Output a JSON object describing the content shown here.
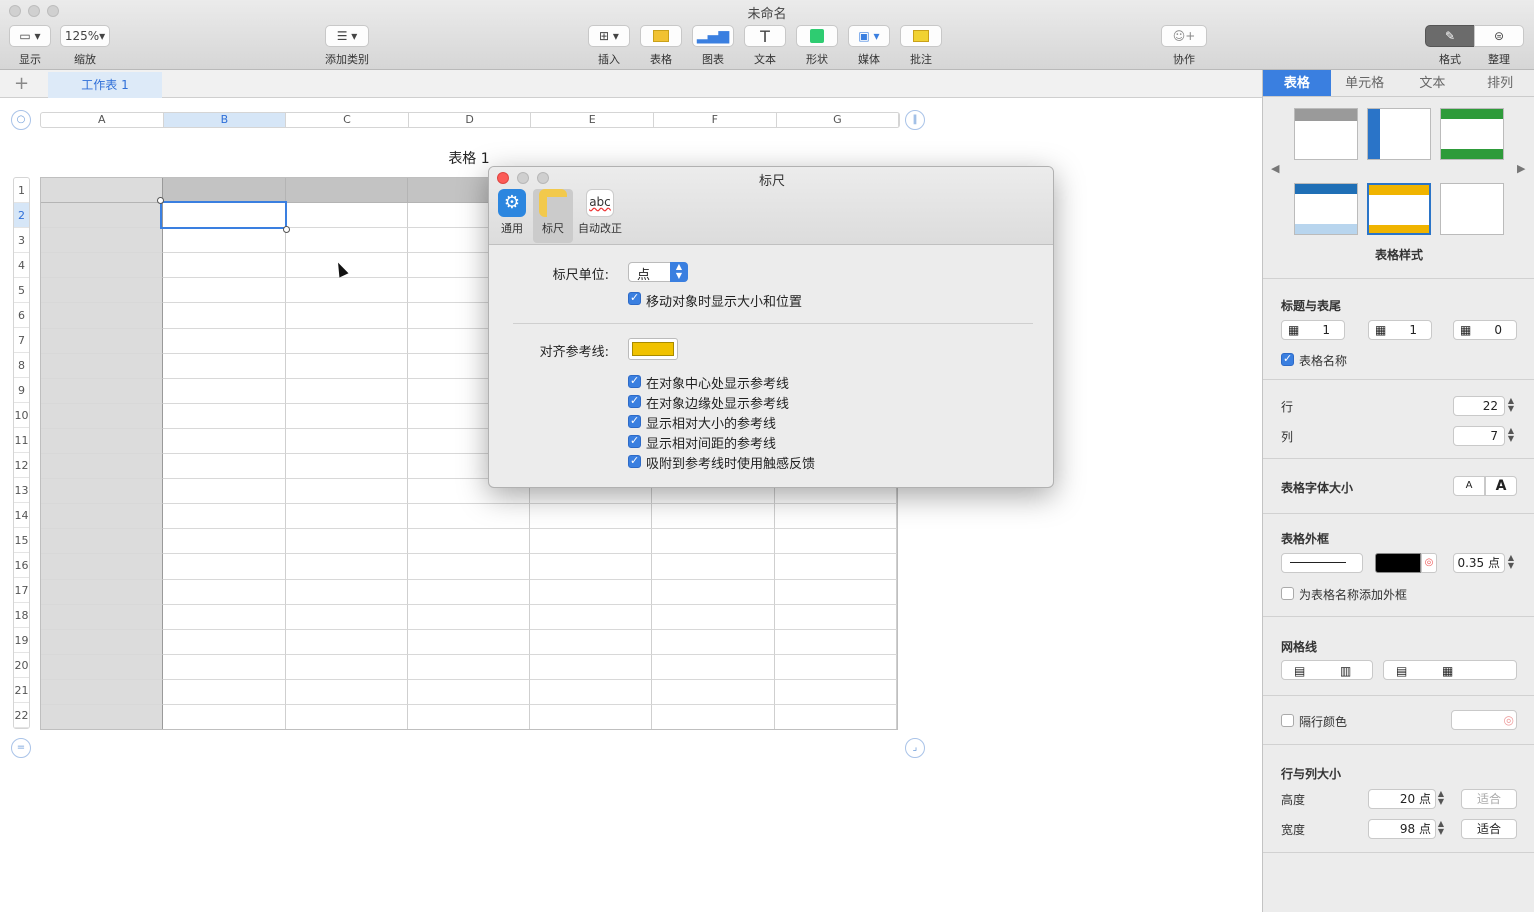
{
  "window": {
    "title": "未命名"
  },
  "toolbar": {
    "view": {
      "label": "显示"
    },
    "zoom": {
      "value": "125%",
      "label": "缩放"
    },
    "add_category": {
      "label": "添加类别"
    },
    "insert": {
      "label": "插入"
    },
    "table": {
      "label": "表格"
    },
    "chart": {
      "label": "图表"
    },
    "text": {
      "label": "文本",
      "glyph": "T"
    },
    "shape": {
      "label": "形状"
    },
    "media": {
      "label": "媒体"
    },
    "comment": {
      "label": "批注"
    },
    "collaborate": {
      "label": "协作"
    },
    "format": {
      "label": "格式"
    },
    "organize": {
      "label": "整理"
    }
  },
  "sheets": {
    "add": "+",
    "active": "工作表 1"
  },
  "spreadsheet": {
    "table_title": "表格 1",
    "columns": [
      "A",
      "B",
      "C",
      "D",
      "E",
      "F",
      "G"
    ],
    "selected_column": "B",
    "rows": [
      "1",
      "2",
      "3",
      "4",
      "5",
      "6",
      "7",
      "8",
      "9",
      "10",
      "11",
      "12",
      "13",
      "14",
      "15",
      "16",
      "17",
      "18",
      "19",
      "20",
      "21",
      "22"
    ],
    "selected_row": "2"
  },
  "inspector": {
    "tabs": [
      "表格",
      "单元格",
      "文本",
      "排列"
    ],
    "active_tab": "表格",
    "styles_label": "表格样式",
    "header_footer": {
      "title": "标题与表尾",
      "header_rows": "1",
      "header_cols": "1",
      "footer_rows": "0"
    },
    "table_name": {
      "label": "表格名称",
      "checked": true
    },
    "rows": {
      "label": "行",
      "value": "22"
    },
    "cols": {
      "label": "列",
      "value": "7"
    },
    "font_size": {
      "label": "表格字体大小",
      "small": "A",
      "large": "A"
    },
    "outline": {
      "title": "表格外框",
      "width": "0.35 点",
      "color": "#000000",
      "name_outline_label": "为表格名称添加外框"
    },
    "gridlines": {
      "title": "网格线"
    },
    "alternating": {
      "label": "隔行颜色"
    },
    "row_col_size": {
      "title": "行与列大小",
      "height_label": "高度",
      "height": "20 点",
      "width_label": "宽度",
      "width": "98 点",
      "fit": "适合"
    }
  },
  "dialog": {
    "title": "标尺",
    "tabs": [
      "通用",
      "标尺",
      "自动改正"
    ],
    "active_tab": "标尺",
    "abc_glyph": "abc",
    "ruler_units": {
      "label": "标尺单位:",
      "value": "点"
    },
    "show_size": "移动对象时显示大小和位置",
    "guides": {
      "label": "对齐参考线:",
      "color": "#f0c200"
    },
    "options": [
      "在对象中心处显示参考线",
      "在对象边缘处显示参考线",
      "显示相对大小的参考线",
      "显示相对间距的参考线",
      "吸附到参考线时使用触感反馈"
    ]
  },
  "colors": {
    "accent": "#3a7fe0"
  }
}
